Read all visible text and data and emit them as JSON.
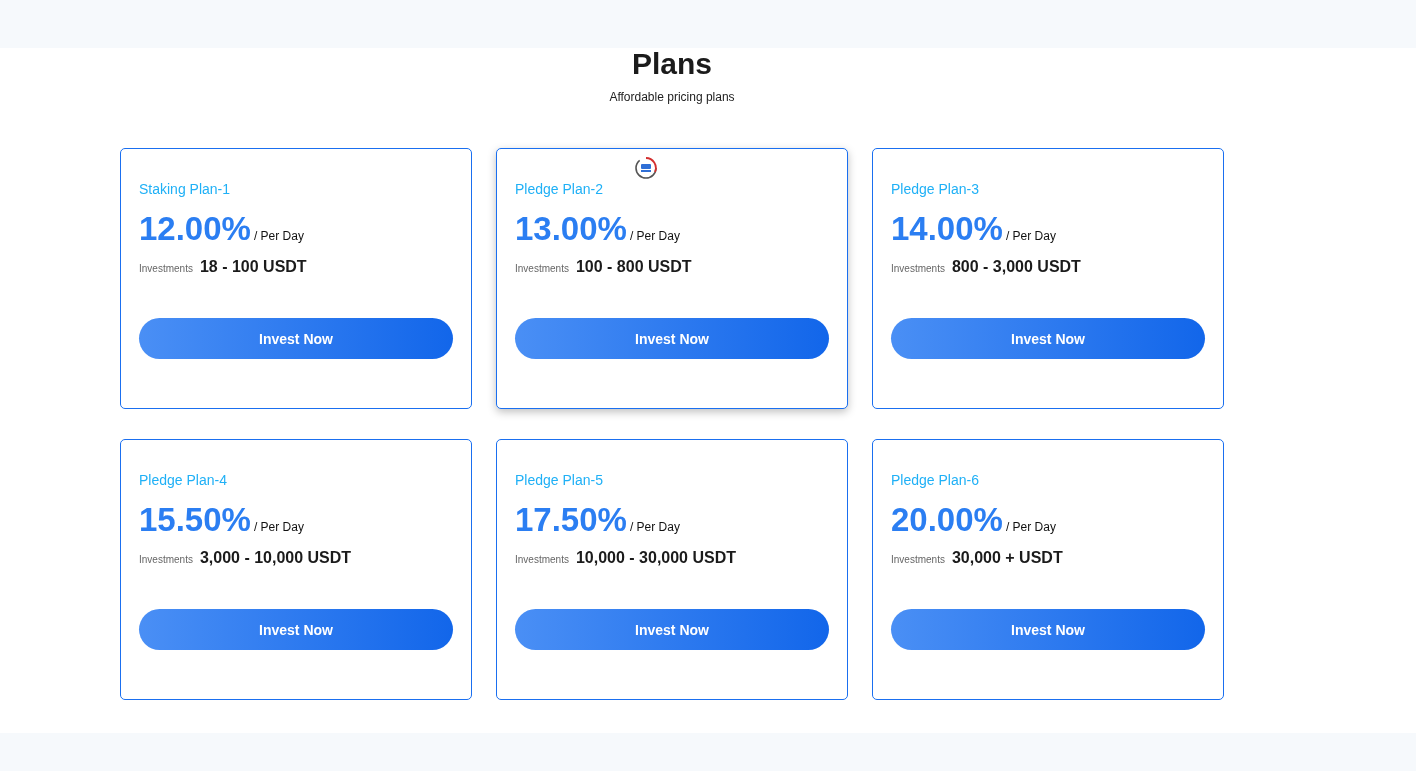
{
  "header": {
    "title": "Plans",
    "subtitle": "Affordable pricing plans"
  },
  "plans": [
    {
      "name": "Staking Plan-1",
      "rate": "12.00%",
      "period": "/ Per Day",
      "investments_label": "Investments",
      "range": "18 - 100 USDT",
      "button": "Invest Now",
      "highlighted": false,
      "service_badge": false
    },
    {
      "name": "Pledge Plan-2",
      "rate": "13.00%",
      "period": "/ Per Day",
      "investments_label": "Investments",
      "range": "100 - 800 USDT",
      "button": "Invest Now",
      "highlighted": true,
      "service_badge": true
    },
    {
      "name": "Pledge Plan-3",
      "rate": "14.00%",
      "period": "/ Per Day",
      "investments_label": "Investments",
      "range": "800 - 3,000 USDT",
      "button": "Invest Now",
      "highlighted": false,
      "service_badge": false
    },
    {
      "name": "Pledge Plan-4",
      "rate": "15.50%",
      "period": "/ Per Day",
      "investments_label": "Investments",
      "range": "3,000 - 10,000 USDT",
      "button": "Invest Now",
      "highlighted": false,
      "service_badge": false
    },
    {
      "name": "Pledge Plan-5",
      "rate": "17.50%",
      "period": "/ Per Day",
      "investments_label": "Investments",
      "range": "10,000 - 30,000 USDT",
      "button": "Invest Now",
      "highlighted": false,
      "service_badge": false
    },
    {
      "name": "Pledge Plan-6",
      "rate": "20.00%",
      "period": "/ Per Day",
      "investments_label": "Investments",
      "range": "30,000 + USDT",
      "button": "Invest Now",
      "highlighted": false,
      "service_badge": false
    }
  ]
}
